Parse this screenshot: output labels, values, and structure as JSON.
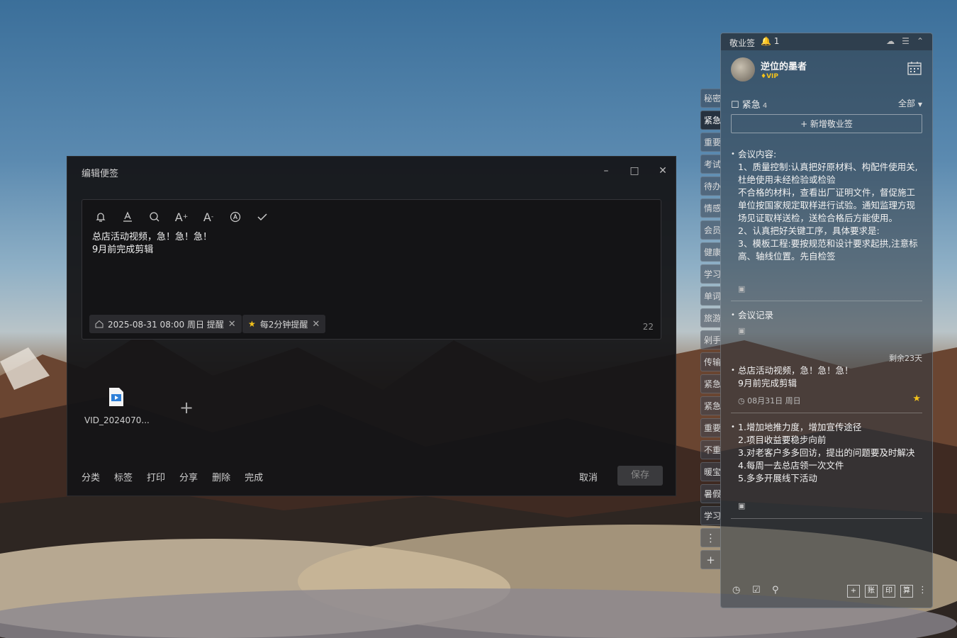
{
  "editor": {
    "title": "编辑便签",
    "content_lines": [
      "总店活动视频，急！急！急！",
      "9月前完成剪辑"
    ],
    "reminder_chip": "2025-08-31 08:00 周日 提醒",
    "repeat_chip": "每2分钟提醒",
    "char_count": "22",
    "attachment_name": "VID_2024070...",
    "links": [
      "分类",
      "标签",
      "打印",
      "分享",
      "删除",
      "完成"
    ],
    "cancel_label": "取消",
    "save_label": "保存"
  },
  "side_tabs": [
    "秘密",
    "紧急",
    "重要",
    "考试",
    "待办",
    "情感",
    "会员",
    "健康",
    "学习",
    "单词",
    "旅游",
    "剁手",
    "传输",
    "紧急",
    "紧急",
    "重要",
    "不重",
    "暖宝",
    "暑假",
    "学习"
  ],
  "panel": {
    "app_name": "敬业签",
    "notif_count": "1",
    "username": "逆位的墨者",
    "vip": "VIP",
    "category": "紧急",
    "category_count": "4",
    "filter": "全部",
    "new_button": "+ 新增敬业签",
    "note1_lines": [
      "会议内容:",
      "1、质量控制:认真把好原材料、构配件使用关,杜绝使用未经检验或检验",
      "不合格的材料，查看出厂证明文件，督促施工单位按国家规定取样进行试验。通知监理方现场见证取样送检，送检合格后方能使用。",
      "2、认真把好关键工序，具体要求是:",
      "3、模板工程:要按规范和设计要求起拱,注意标高、轴线位置。先自检签"
    ],
    "note2": "会议记录",
    "remaining": "剩余23天",
    "note3_lines": [
      "总店活动视频，急！急！急！",
      "9月前完成剪辑"
    ],
    "note3_meta": "08月31日 周日",
    "note4_lines": [
      "1.增加地推力度，增加宣传途径",
      "2.项目收益要稳步向前",
      "3.对老客户多多回访，提出的问题要及时解决",
      "4.每周一去总店领一次文件",
      "5.多多开展线下活动"
    ],
    "footer_boxes": [
      "+",
      "账",
      "印",
      "算"
    ]
  }
}
